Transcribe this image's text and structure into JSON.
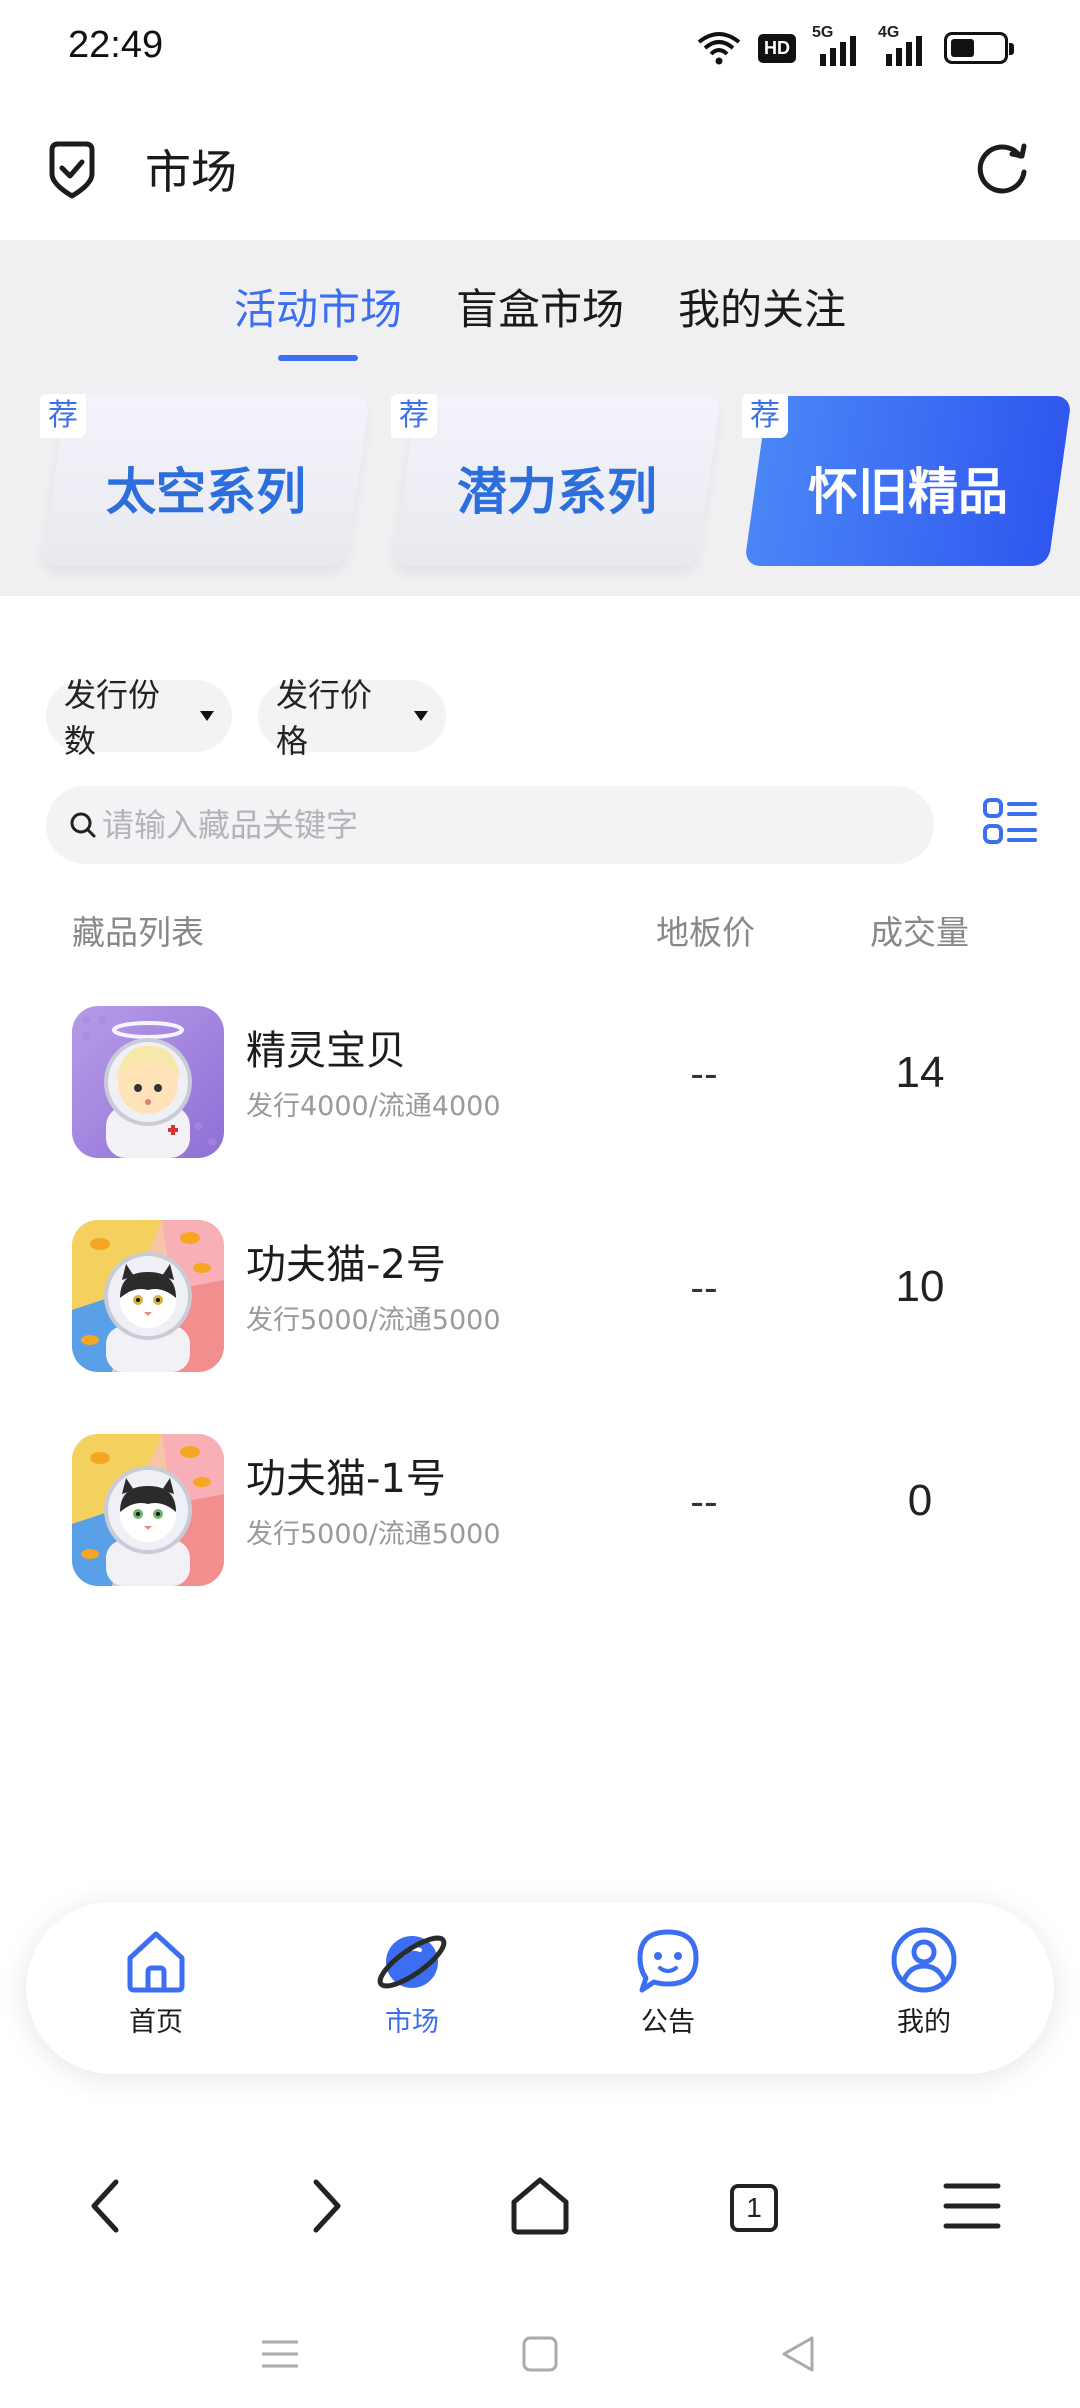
{
  "status": {
    "time": "22:49",
    "hd": "HD",
    "net1": "5G",
    "net2": "4G",
    "battery_level": 0.45
  },
  "header": {
    "title": "市场"
  },
  "tabs": [
    {
      "label": "活动市场",
      "active": true
    },
    {
      "label": "盲盒市场",
      "active": false
    },
    {
      "label": "我的关注",
      "active": false
    }
  ],
  "series_cards": [
    {
      "label": "太空系列",
      "badge": "荐",
      "active": false
    },
    {
      "label": "潜力系列",
      "badge": "荐",
      "active": false
    },
    {
      "label": "怀旧精品",
      "badge": "荐",
      "active": true
    }
  ],
  "filters": {
    "count": "发行份数",
    "price": "发行价格"
  },
  "search": {
    "placeholder": "请输入藏品关键字"
  },
  "columns": {
    "name": "藏品列表",
    "floor": "地板价",
    "volume": "成交量"
  },
  "items": [
    {
      "name": "精灵宝贝",
      "sub": "发行4000/流通4000",
      "floor": "--",
      "volume": "14"
    },
    {
      "name": "功夫猫-2号",
      "sub": "发行5000/流通5000",
      "floor": "--",
      "volume": "10"
    },
    {
      "name": "功夫猫-1号",
      "sub": "发行5000/流通5000",
      "floor": "--",
      "volume": "0"
    }
  ],
  "nav": [
    {
      "label": "首页",
      "active": false
    },
    {
      "label": "市场",
      "active": true
    },
    {
      "label": "公告",
      "active": false
    },
    {
      "label": "我的",
      "active": false
    }
  ],
  "browser": {
    "tab_count": "1"
  },
  "colors": {
    "accent": "#3b6ef0",
    "card_gradient_start": "#4a86f7",
    "card_gradient_end": "#2f57ef",
    "gray_bg": "#f0f0f2"
  }
}
